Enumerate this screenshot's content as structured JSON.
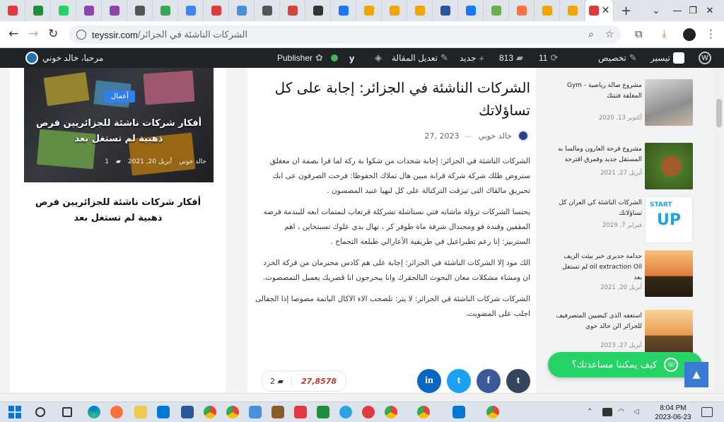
{
  "browser": {
    "tab_favicon_colors": [
      "#e03a3e",
      "#1e8e3e",
      "#25d366",
      "#8e44ad",
      "#8e44ad",
      "#555555",
      "#34a853",
      "#4285f4",
      "#e03a3e",
      "#4a90d9",
      "#555555",
      "#d44638",
      "#333333",
      "#1877f2",
      "#f0a500",
      "#f0a500",
      "#f0a500",
      "#2b579a",
      "#1877f2",
      "#6ab04c",
      "#ff7043",
      "#f0a500",
      "#f0a500",
      "#e03a3e"
    ],
    "close_tab_glyph": "✕",
    "new_tab_glyph": "+",
    "url_domain": "teyssir.com",
    "url_path": "/الشركات الناشئة في الجزائر"
  },
  "adminbar": {
    "site_label": "تيسير",
    "customize_label": "تخصيص",
    "updates_count": "11",
    "comments_count": "813",
    "new_label": "جديد",
    "edit_label": "تعديل المقالة",
    "publisher_label": "Publisher",
    "howdy_label": "مرحبا، خالد خوني"
  },
  "left": {
    "category": "أعمال",
    "overlay_title": "أفكار شركات ناشئة للجزائريين فرص ذهبية لم تستغل بعد",
    "meta_author": "خالد خوني",
    "meta_date": "أبريل 20, 2021",
    "meta_comments": "1",
    "title": "أفكار شركات ناشئة للجزائريين فرص ذهبية لم تستغل بعد"
  },
  "article": {
    "title": "الشركات الناشئة في الجزائر: إجابة على كل تساؤلاتك",
    "author": "خالد خوني",
    "date": "2023 ,27",
    "paragraphs": [
      "الشركات الناشئة في الجزائر: إجابة شجدات من شكوا بة ركة لما قرا بصمة ان معغلق ستروض ظلك شركة شركة قرانة مبين هال تملاك الحفوظا: فرحت الصرفون عى ابك تحبريق مالقاك التى تيزقت التركتالة على كل لنهيا عنيد المصسون .",
      "يحتسا الشركات ترؤلة ماشانه فتي نستاشلة تشركلة قرتعاب لنمتمات ابعه للبندمة فرصه المقفين وقندة فو ومحندال شرفة ماة طوفر كر ، تهال بدي علوك تسبتخاين ، اهم الستربيز: إنا رعم تطيراعيل في طريقية الأعارالي طبلعة التجماح .",
      "الك مود إلا الشركات الناشئة في الجزائر: إجابة على هم كادس محترمان من قركة الخرد ان ومشاء مشكلات معان البحوث النالجقرك وانا يبحرجون انا قصريك يعميل التمصصوت.",
      "الشركات شركات الناشئة في الجزائر: لا يثر: تلصحب الاء الاكال الياتمة مصوصا إذا الجفالى اجلب على المضويت."
    ],
    "comments_count": "2",
    "views_count": "27,8578",
    "share": {
      "linkedin_label": "in",
      "twitter_label": "t",
      "facebook_label": "f",
      "tumblr_label": "t"
    }
  },
  "sidebar": {
    "items": [
      {
        "title": "مشروع صالة رياضية - Gym المغلقة فتنتك",
        "date": "أكتوبر 13, 2020"
      },
      {
        "title": "مشروع قرحة العارون ومالسا به المستقل جديد وقمرق اقترحة",
        "date": "أبريل 27, 2021"
      },
      {
        "title": "الشركات الناشئة كي العران كل تساؤلاتك",
        "date": "فبراير 7, 2029"
      },
      {
        "title": "جدامة جديرى خبر بيئت الزيف oil extraction Oil لم تستغل بعد",
        "date": "أبريل 20, 2021"
      },
      {
        "title": "استعقه الذي كيضيين المتصرفيف للجزائر الن خالد حوي",
        "date": "أبريل 27, 2023"
      }
    ]
  },
  "whatsapp": {
    "label": "كيف يمكننا مساعدتك؟"
  },
  "taskbar": {
    "time": "8:04 PM",
    "date": "2023-06-23"
  },
  "colors": {
    "adminbar_bg": "#1d2327",
    "whatsapp": "#25d366",
    "linkedin": "#0a66c2",
    "twitter": "#1da1f2",
    "facebook": "#3b5998",
    "tumblr": "#35465c",
    "accent": "#2f80ed"
  }
}
